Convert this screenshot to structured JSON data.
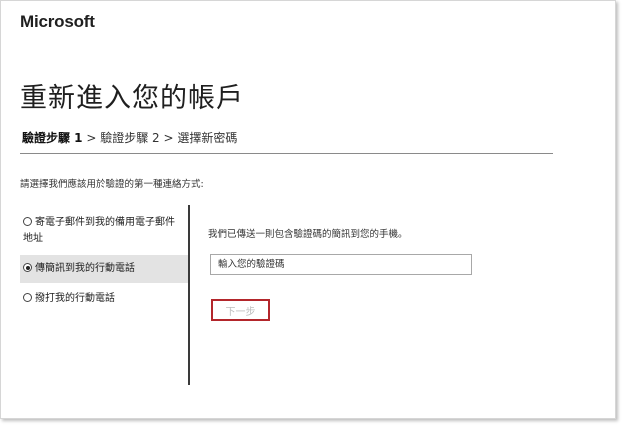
{
  "brand": "Microsoft",
  "page_title": "重新進入您的帳戶",
  "steps": {
    "step1": "驗證步驟 1",
    "sep1": " > ",
    "step2": "驗證步驟 2",
    "sep2": " > ",
    "step3": "選擇新密碼"
  },
  "prompt": "請選擇我們應該用於驗證的第一種連絡方式:",
  "options": [
    {
      "label": "寄電子郵件到我的備用電子郵件地址",
      "selected": false
    },
    {
      "label": "傳簡訊到我的行動電話",
      "selected": true
    },
    {
      "label": "撥打我的行動電話",
      "selected": false
    }
  ],
  "detail_text": "我們已傳送一則包含驗證碼的簡訊到您的手機。",
  "code_input": {
    "placeholder": "輸入您的驗證碼",
    "value": ""
  },
  "next_button": "下一步",
  "colors": {
    "button_border": "#b3262b",
    "selected_bg": "#e3e3e3"
  }
}
